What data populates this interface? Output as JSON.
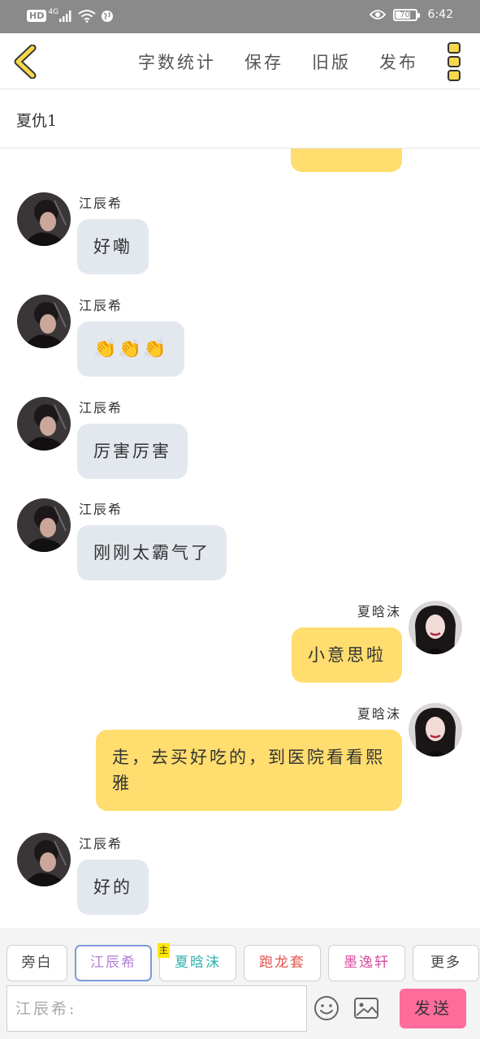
{
  "status_bar": {
    "network_badge": "HD",
    "network_type": "4G",
    "battery_level": "70",
    "time": "6:42"
  },
  "header": {
    "actions": [
      "字数统计",
      "保存",
      "旧版",
      "发布"
    ]
  },
  "chat_title": "夏仇1",
  "messages": [
    {
      "side": "left",
      "sender": "江辰希",
      "text": "好嘞"
    },
    {
      "side": "left",
      "sender": "江辰希",
      "text": "👏👏👏",
      "emoji": true
    },
    {
      "side": "left",
      "sender": "江辰希",
      "text": "厉害厉害"
    },
    {
      "side": "left",
      "sender": "江辰希",
      "text": "刚刚太霸气了"
    },
    {
      "side": "right",
      "sender": "夏晗沫",
      "text": "小意思啦"
    },
    {
      "side": "right",
      "sender": "夏晗沫",
      "text": "走，去买好吃的，到医院看看熙雅"
    },
    {
      "side": "left",
      "sender": "江辰希",
      "text": "好的"
    }
  ],
  "roles": [
    {
      "label": "旁白",
      "color": "#444444"
    },
    {
      "label": "江辰希",
      "color": "#b07fd6",
      "selected": true
    },
    {
      "label": "夏晗沫",
      "color": "#2fb3b0",
      "badge": "主"
    },
    {
      "label": "跑龙套",
      "color": "#e5534b"
    },
    {
      "label": "墨逸轩",
      "color": "#d94fa0"
    },
    {
      "label": "更多",
      "color": "#444444"
    }
  ],
  "input": {
    "placeholder": "江辰希:",
    "value": ""
  },
  "send_label": "发送",
  "colors": {
    "accent_yellow": "#ffdd6e",
    "left_bubble": "#e3e8ef",
    "send_pink": "#ff6c9b",
    "icon_yellow": "#f5d84c"
  }
}
